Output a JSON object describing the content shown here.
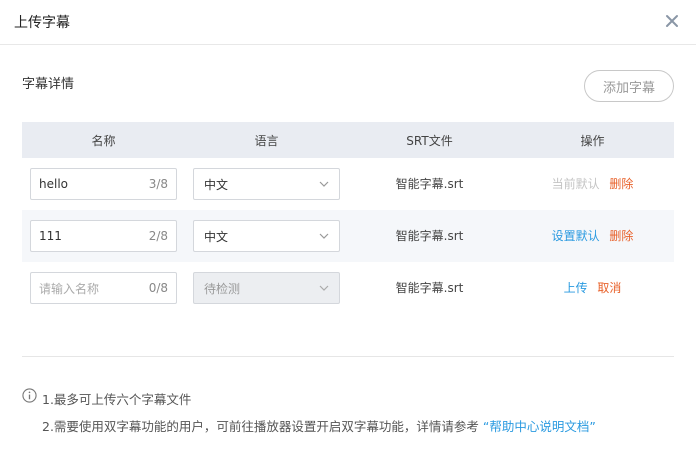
{
  "dialog": {
    "title": "上传字幕"
  },
  "section": {
    "title": "字幕详情",
    "add_button": "添加字幕"
  },
  "table": {
    "headers": [
      "名称",
      "语言",
      "SRT文件",
      "操作"
    ],
    "rows": [
      {
        "name": "hello",
        "name_count": "3/8",
        "language": "中文",
        "srt": "智能字幕.srt",
        "op1": "当前默认",
        "op2": "删除"
      },
      {
        "name": "111",
        "name_count": "2/8",
        "language": "中文",
        "srt": "智能字幕.srt",
        "op1": "设置默认",
        "op2": "删除"
      },
      {
        "name_placeholder": "请输入名称",
        "name_count": "0/8",
        "language": "待检测",
        "srt": "智能字幕.srt",
        "op1": "上传",
        "op2": "取消"
      }
    ]
  },
  "notes": {
    "line1": "1.最多可上传六个字幕文件",
    "line2_prefix": "2.需要使用双字幕功能的用户，可前往播放器设置开启双字幕功能，详情请参考",
    "line2_link": "“帮助中心说明文档”"
  },
  "colors": {
    "link_blue": "#2a9ae0",
    "danger_orange": "#e8612a",
    "disabled_gray": "#c4c4c4",
    "header_bg": "#e9ecf2"
  },
  "icons": {
    "close": "close-icon",
    "chevron": "chevron-down-icon",
    "info": "info-icon"
  }
}
